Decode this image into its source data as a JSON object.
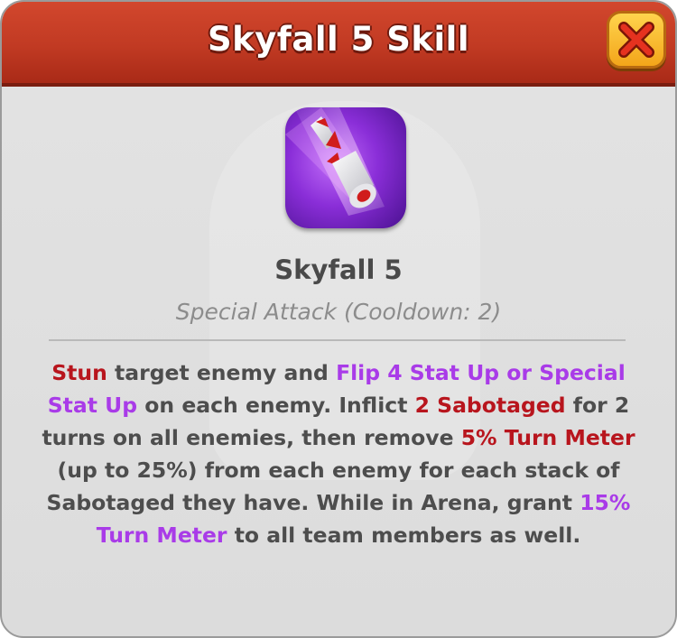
{
  "window": {
    "title": "Skyfall 5 Skill"
  },
  "skill": {
    "icon": "skyfall-missile-icon",
    "name": "Skyfall 5",
    "subtitle": "Special Attack (Cooldown: 2)"
  },
  "colors": {
    "header": "#c13a23",
    "keyword_red": "#b8151d",
    "keyword_purple": "#a93be8",
    "body_text": "#4d4d4d",
    "subtitle": "#8c8c8c"
  },
  "description": {
    "stun": "Stun",
    "t1": " target enemy and ",
    "flip": "Flip 4 Stat Up or Special Stat Up",
    "t2": " on each enemy. Inflict ",
    "sabotaged": "2 Sabotaged",
    "t3": " for 2 turns on all enemies, then remove ",
    "tm_remove": "5% Turn Meter",
    "t4": " (up to 25%) from each enemy for each stack of Sabotaged they have. While in Arena, grant ",
    "tm_grant": "15% Turn Meter",
    "t5": " to all team members as well."
  }
}
